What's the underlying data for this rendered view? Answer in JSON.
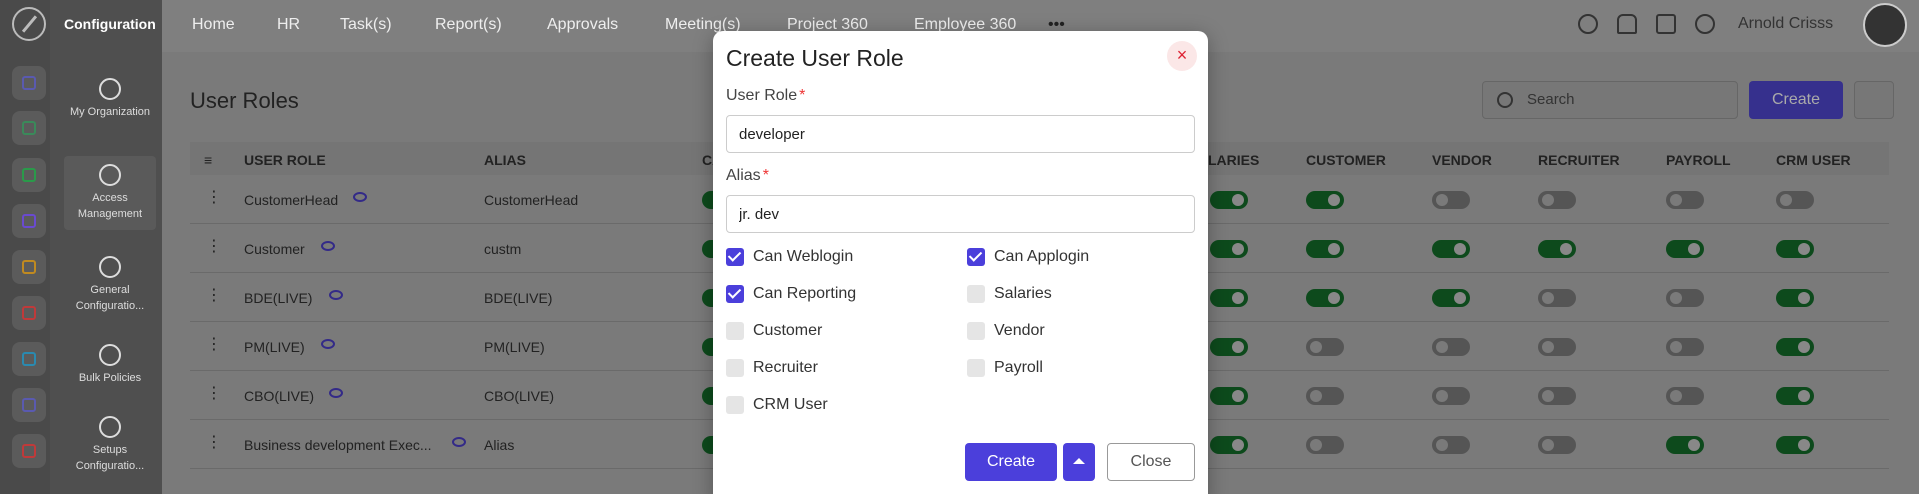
{
  "sidebar": {
    "title": "Configuration",
    "items": [
      {
        "label": "My Organization"
      },
      {
        "label": "Access Management"
      },
      {
        "label": "General Configuratio..."
      },
      {
        "label": "Bulk Policies"
      },
      {
        "label": "Setups Configuratio..."
      }
    ],
    "rail_icons": [
      "home-icon",
      "users-icon",
      "lock-icon",
      "box-icon",
      "people-icon",
      "chart-icon",
      "archive-icon",
      "layers-icon",
      "monitor-icon"
    ]
  },
  "nav": {
    "items": [
      "Home",
      "HR",
      "Task(s)",
      "Report(s)",
      "Approvals",
      "Meeting(s)",
      "Project 360",
      "Employee 360"
    ],
    "more": "•••"
  },
  "user": {
    "name": "Arnold Crisss"
  },
  "page": {
    "title": "User Roles",
    "search_placeholder": "Search",
    "create_label": "Create"
  },
  "table": {
    "columns": [
      "USER ROLE",
      "ALIAS",
      "CA",
      "LARIES",
      "CUSTOMER",
      "VENDOR",
      "RECRUITER",
      "PAYROLL",
      "CRM USER"
    ],
    "rows": [
      {
        "name": "CustomerHead",
        "alias": "CustomerHead",
        "toggles": [
          true,
          true,
          true,
          false,
          false,
          false,
          false
        ]
      },
      {
        "name": "Customer",
        "alias": "custm",
        "toggles": [
          true,
          true,
          true,
          true,
          true,
          true,
          true
        ]
      },
      {
        "name": "BDE(LIVE)",
        "alias": "BDE(LIVE)",
        "toggles": [
          true,
          true,
          true,
          true,
          false,
          false,
          true
        ]
      },
      {
        "name": "PM(LIVE)",
        "alias": "PM(LIVE)",
        "toggles": [
          true,
          true,
          false,
          false,
          false,
          false,
          true
        ]
      },
      {
        "name": "CBO(LIVE)",
        "alias": "CBO(LIVE)",
        "toggles": [
          true,
          true,
          false,
          false,
          false,
          false,
          true
        ]
      },
      {
        "name": "Business development Exec...",
        "alias": "Alias",
        "toggles": [
          true,
          true,
          false,
          false,
          false,
          true,
          true
        ]
      }
    ]
  },
  "modal": {
    "title": "Create User Role",
    "close_glyph": "×",
    "user_role_label": "User Role",
    "user_role_value": "developer",
    "alias_label": "Alias",
    "alias_value": "jr. dev",
    "required_mark": "*",
    "checkboxes": [
      {
        "label": "Can Weblogin",
        "checked": true
      },
      {
        "label": "Can Applogin",
        "checked": true
      },
      {
        "label": "Can Reporting",
        "checked": true
      },
      {
        "label": "Salaries",
        "checked": false
      },
      {
        "label": "Customer",
        "checked": false
      },
      {
        "label": "Vendor",
        "checked": false
      },
      {
        "label": "Recruiter",
        "checked": false
      },
      {
        "label": "Payroll",
        "checked": false
      },
      {
        "label": "CRM User",
        "checked": false
      }
    ],
    "create_label": "Create",
    "close_label": "Close"
  },
  "colors": {
    "primary": "#4b3fdb",
    "toggle_on": "#1a8a36",
    "danger": "#e33333"
  }
}
